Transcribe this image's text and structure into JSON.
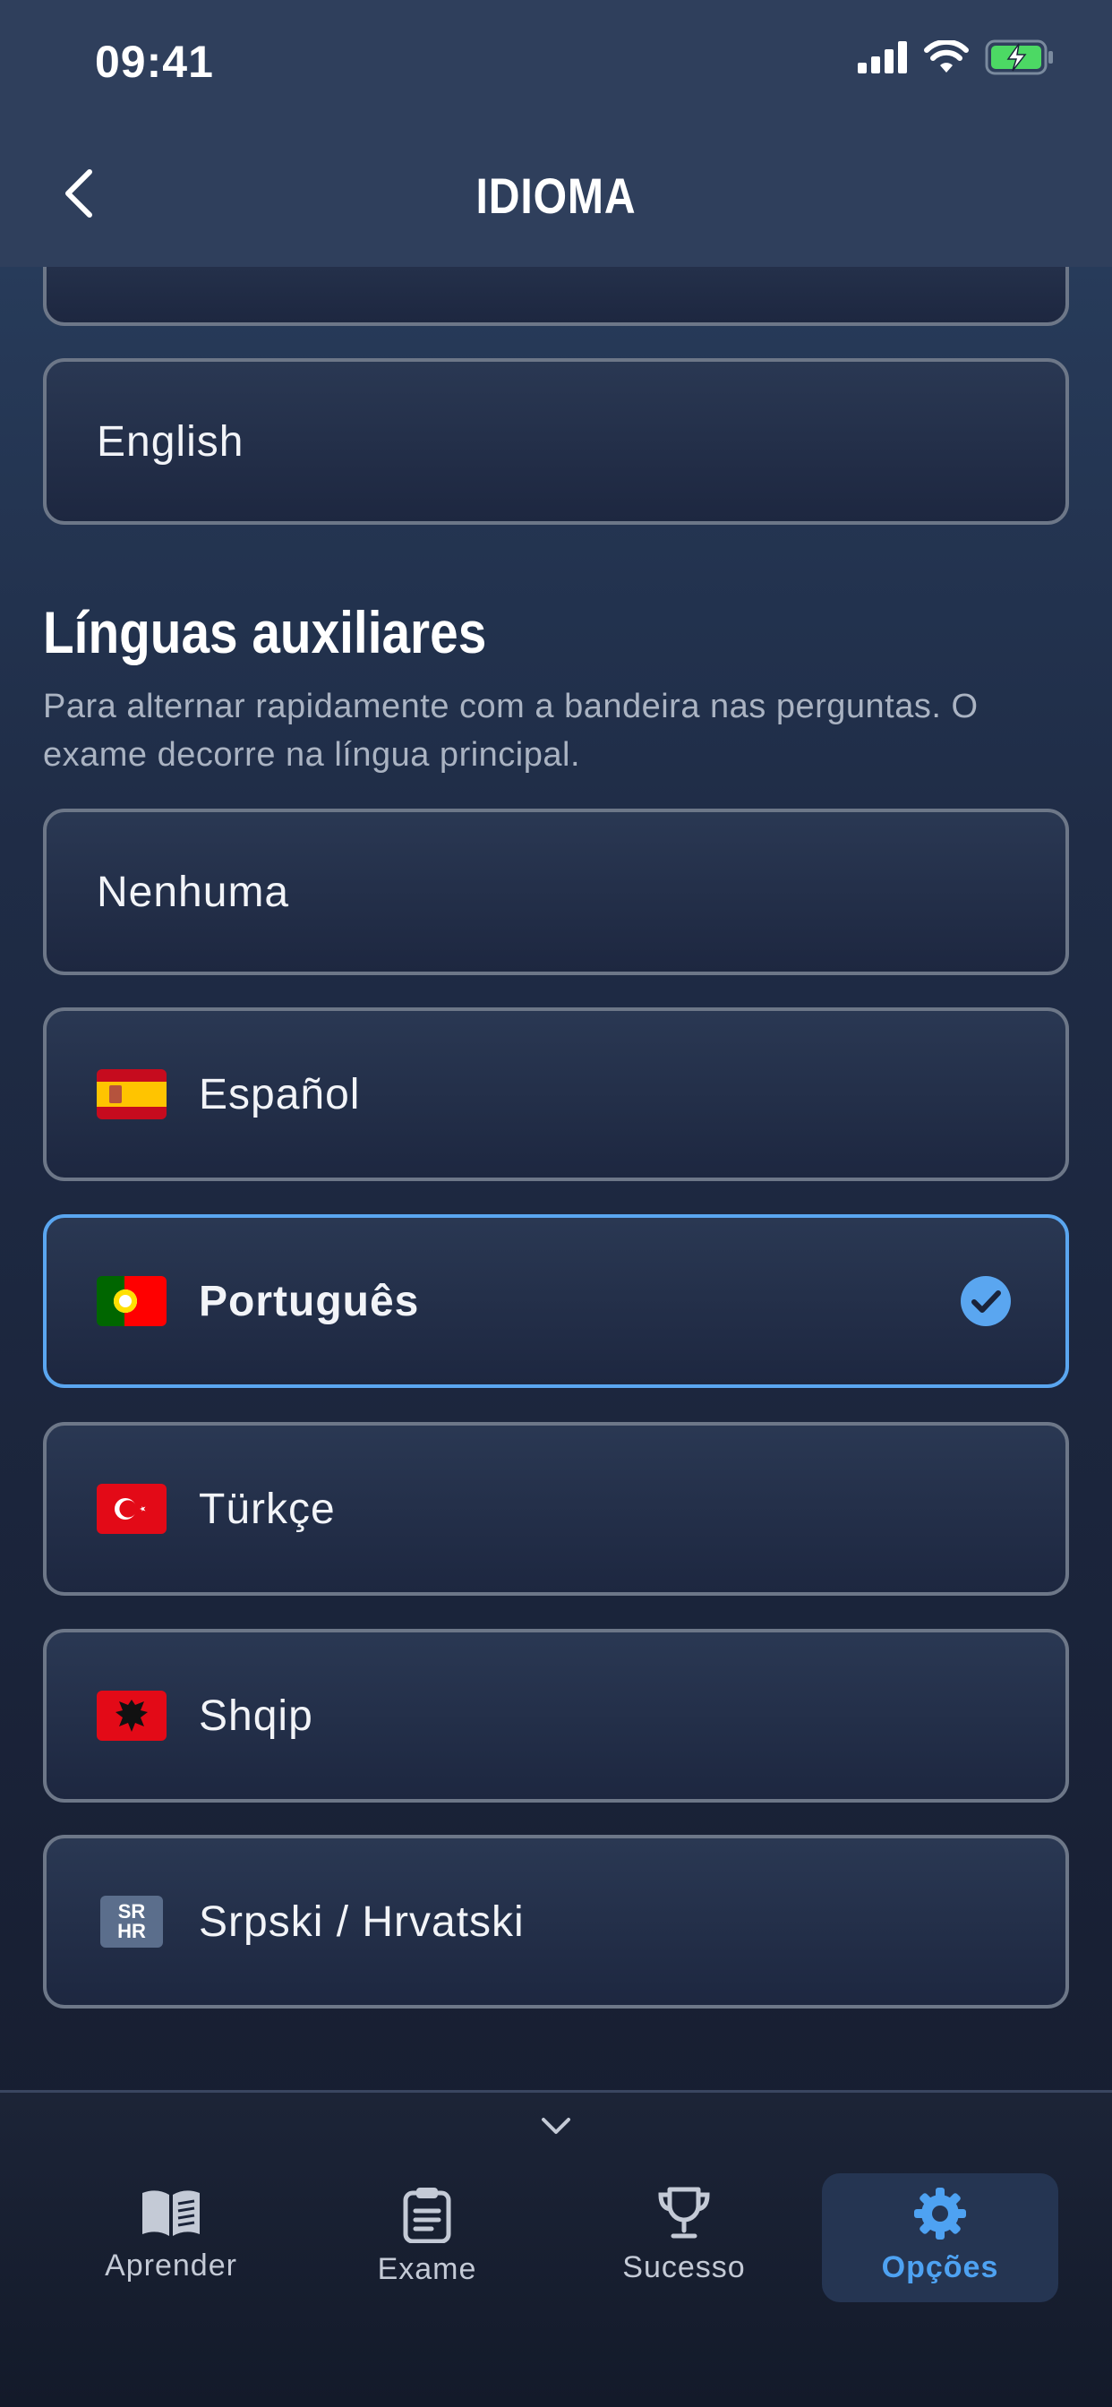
{
  "status_bar": {
    "time": "09:41"
  },
  "header": {
    "title": "IDIOMA",
    "back_icon": "chevron-left-icon"
  },
  "primary_language": {
    "selected_label": "English"
  },
  "auxiliary": {
    "title": "Línguas auxiliares",
    "subtitle": "Para alternar rapidamente com a bandeira nas perguntas. O exame decorre na língua principal.",
    "options": [
      {
        "label": "Nenhuma",
        "flag": "none",
        "selected": false
      },
      {
        "label": "Español",
        "flag": "spain-flag",
        "selected": false
      },
      {
        "label": "Português",
        "flag": "portugal-flag",
        "selected": true
      },
      {
        "label": "Türkçe",
        "flag": "turkey-flag",
        "selected": false
      },
      {
        "label": "Shqip",
        "flag": "albania-flag",
        "selected": false
      },
      {
        "label": "Srpski / Hrvatski",
        "flag": "sr-hr-badge",
        "selected": false
      }
    ],
    "srhr_badge": {
      "top": "SR",
      "bottom": "HR"
    }
  },
  "colors": {
    "accent": "#4ea2f2",
    "card_border": "#6d7788",
    "selected_border": "#5aa6f0"
  },
  "tabbar": {
    "tabs": [
      {
        "label": "Aprender",
        "icon": "open-book-icon",
        "active": false
      },
      {
        "label": "Exame",
        "icon": "clipboard-icon",
        "active": false
      },
      {
        "label": "Sucesso",
        "icon": "trophy-icon",
        "active": false
      },
      {
        "label": "Opções",
        "icon": "gear-icon",
        "active": true
      }
    ]
  }
}
